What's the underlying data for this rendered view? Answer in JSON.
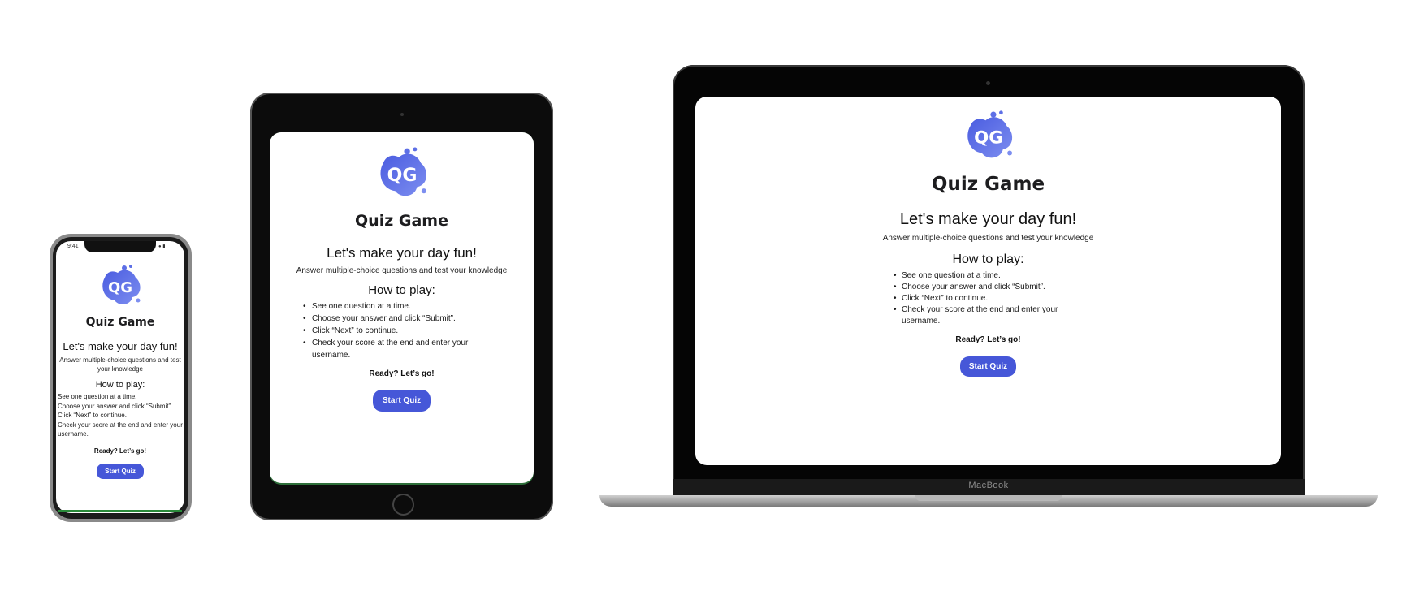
{
  "app": {
    "title": "Quiz Game",
    "headline": "Let's make your day fun!",
    "subtitle": "Answer multiple-choice questions and test your knowledge",
    "how_to_heading": "How to play:",
    "steps": [
      "See one question at a time.",
      "Choose your answer and click “Submit”.",
      "Click “Next” to continue.",
      "Check your score at the end and enter your username."
    ],
    "ready_text": "Ready? Let’s go!",
    "start_button": "Start Quiz",
    "logo_text": "QG",
    "accent_color": "#4657d8"
  },
  "devices": {
    "phone": {
      "status_time": "9:41",
      "status_icons": "● ▮"
    },
    "laptop": {
      "brand_label": "MacBook"
    }
  }
}
